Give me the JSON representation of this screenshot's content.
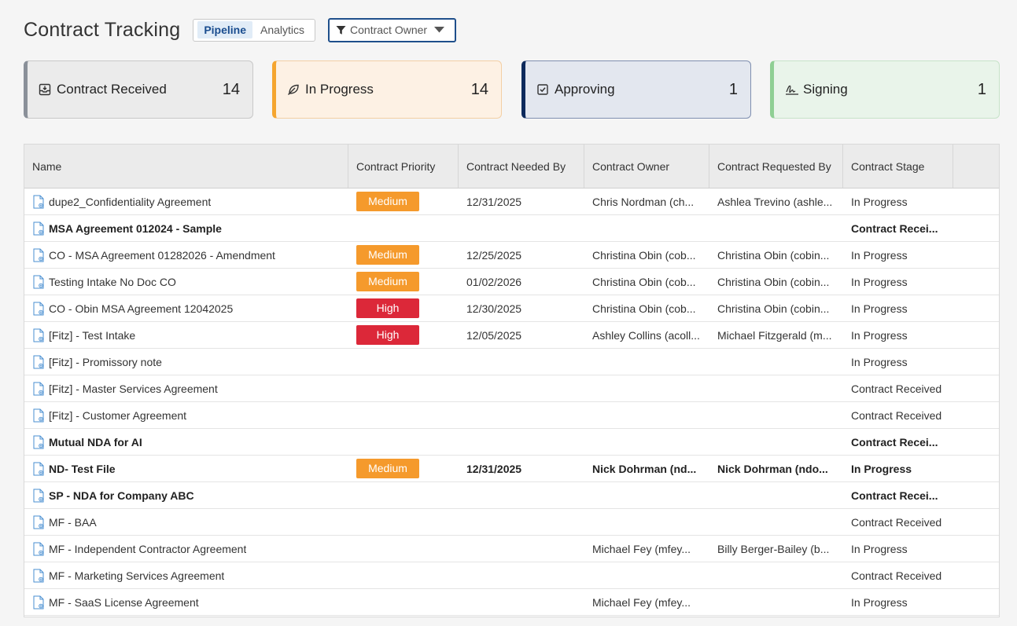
{
  "header": {
    "title": "Contract Tracking",
    "tabs": [
      {
        "label": "Pipeline",
        "active": true
      },
      {
        "label": "Analytics",
        "active": false
      }
    ],
    "filter_label": "Contract Owner"
  },
  "cards": [
    {
      "label": "Contract Received",
      "count": "14",
      "icon": "inbox-icon",
      "bg": "#ebebeb",
      "border": "#c8c8c8",
      "accent": "#8a9099"
    },
    {
      "label": "In Progress",
      "count": "14",
      "icon": "leaf-icon",
      "bg": "#fdf1e4",
      "border": "#f3cfa4",
      "accent": "#f5a52f"
    },
    {
      "label": "Approving",
      "count": "1",
      "icon": "checkbox-icon",
      "bg": "#e3e7ef",
      "border": "#7f8fb0",
      "accent": "#0d2a5c"
    },
    {
      "label": "Signing",
      "count": "1",
      "icon": "signature-icon",
      "bg": "#e9f4ea",
      "border": "#c7e3c9",
      "accent": "#8fcf94"
    }
  ],
  "table": {
    "columns": [
      "Name",
      "Contract Priority",
      "Contract Needed By",
      "Contract Owner",
      "Contract Requested By",
      "Contract Stage"
    ],
    "rows": [
      {
        "name": "dupe2_Confidentiality Agreement",
        "priority": "Medium",
        "needed_by": "12/31/2025",
        "owner": "Chris Nordman (ch...",
        "requested_by": "Ashlea Trevino (ashle...",
        "stage": "In Progress",
        "bold": false
      },
      {
        "name": "MSA Agreement 012024 - Sample",
        "priority": "",
        "needed_by": "",
        "owner": "",
        "requested_by": "",
        "stage": "Contract Recei...",
        "bold": true
      },
      {
        "name": "CO - MSA Agreement 01282026 - Amendment",
        "priority": "Medium",
        "needed_by": "12/25/2025",
        "owner": "Christina Obin (cob...",
        "requested_by": "Christina Obin (cobin...",
        "stage": "In Progress",
        "bold": false
      },
      {
        "name": "Testing Intake No Doc CO",
        "priority": "Medium",
        "needed_by": "01/02/2026",
        "owner": "Christina Obin (cob...",
        "requested_by": "Christina Obin (cobin...",
        "stage": "In Progress",
        "bold": false
      },
      {
        "name": "CO - Obin MSA Agreement 12042025",
        "priority": "High",
        "needed_by": "12/30/2025",
        "owner": "Christina Obin (cob...",
        "requested_by": "Christina Obin (cobin...",
        "stage": "In Progress",
        "bold": false
      },
      {
        "name": "[Fitz] - Test Intake",
        "priority": "High",
        "needed_by": "12/05/2025",
        "owner": "Ashley Collins (acoll...",
        "requested_by": "Michael Fitzgerald (m...",
        "stage": "In Progress",
        "bold": false
      },
      {
        "name": "[Fitz] - Promissory note",
        "priority": "",
        "needed_by": "",
        "owner": "",
        "requested_by": "",
        "stage": "In Progress",
        "bold": false
      },
      {
        "name": "[Fitz] - Master Services Agreement",
        "priority": "",
        "needed_by": "",
        "owner": "",
        "requested_by": "",
        "stage": "Contract Received",
        "bold": false
      },
      {
        "name": "[Fitz] - Customer Agreement",
        "priority": "",
        "needed_by": "",
        "owner": "",
        "requested_by": "",
        "stage": "Contract Received",
        "bold": false
      },
      {
        "name": "Mutual NDA for AI",
        "priority": "",
        "needed_by": "",
        "owner": "",
        "requested_by": "",
        "stage": "Contract Recei...",
        "bold": true
      },
      {
        "name": "ND- Test File",
        "priority": "Medium",
        "needed_by": "12/31/2025",
        "owner": "Nick Dohrman (nd...",
        "requested_by": "Nick Dohrman (ndo...",
        "stage": "In Progress",
        "bold": true
      },
      {
        "name": "SP - NDA for Company ABC",
        "priority": "",
        "needed_by": "",
        "owner": "",
        "requested_by": "",
        "stage": "Contract Recei...",
        "bold": true
      },
      {
        "name": "MF - BAA",
        "priority": "",
        "needed_by": "",
        "owner": "",
        "requested_by": "",
        "stage": "Contract Received",
        "bold": false
      },
      {
        "name": "MF - Independent Contractor Agreement",
        "priority": "",
        "needed_by": "",
        "owner": "Michael Fey (mfey...",
        "requested_by": "Billy Berger-Bailey (b...",
        "stage": "In Progress",
        "bold": false
      },
      {
        "name": "MF - Marketing Services Agreement",
        "priority": "",
        "needed_by": "",
        "owner": "",
        "requested_by": "",
        "stage": "Contract Received",
        "bold": false
      },
      {
        "name": "MF - SaaS License Agreement",
        "priority": "",
        "needed_by": "",
        "owner": "Michael Fey (mfey...",
        "requested_by": "",
        "stage": "In Progress",
        "bold": false
      }
    ]
  }
}
